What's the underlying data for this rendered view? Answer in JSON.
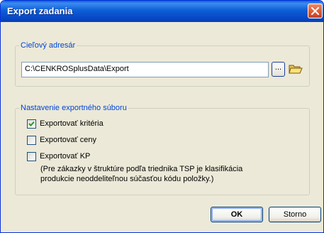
{
  "dialog": {
    "title": "Export zadania"
  },
  "target_directory": {
    "group_label": "Cieľový adresár",
    "path_value": "C:\\CENKROSplusData\\Export",
    "browse_label": "..."
  },
  "export_settings": {
    "group_label": "Nastavenie exportného súboru",
    "options": [
      {
        "label": "Exportovať kritéria",
        "checked": true
      },
      {
        "label": "Exportovať ceny",
        "checked": false
      },
      {
        "label": "Exportovať KP",
        "checked": false
      }
    ],
    "note_lines": [
      "(Pre zákazky v štruktúre podľa triednika TSP je klasifikácia",
      "produkcie neoddeliteľnou súčasťou kódu položky.)"
    ]
  },
  "buttons": {
    "ok_label": "OK",
    "cancel_label": "Storno"
  },
  "icons": {
    "close": "close-icon",
    "folder": "folder-open-icon",
    "check": "checkmark-icon"
  },
  "colors": {
    "titlebar": "#0a5fd8",
    "group_label": "#0046d5",
    "dialog_bg": "#ece9d8",
    "close_button": "#de5d3a"
  }
}
